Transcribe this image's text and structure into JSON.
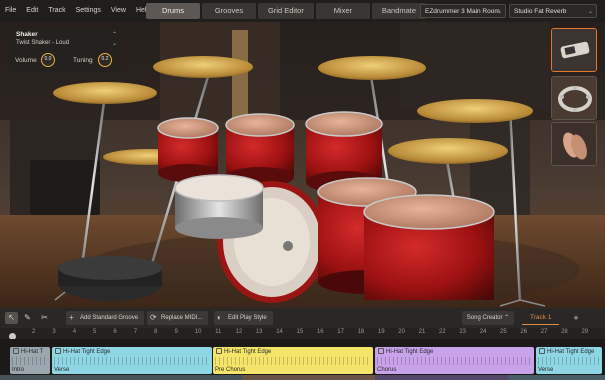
{
  "menubar": {
    "items": [
      "File",
      "Edit",
      "Track",
      "Settings",
      "View",
      "Help"
    ]
  },
  "tabs": [
    {
      "label": "Drums",
      "active": true
    },
    {
      "label": "Grooves",
      "active": false
    },
    {
      "label": "Grid Editor",
      "active": false
    },
    {
      "label": "Mixer",
      "active": false
    },
    {
      "label": "Bandmate",
      "active": false
    }
  ],
  "presets": {
    "room": "EZdrummer 3 Main Room",
    "reverb": "Studio Fat Reverb"
  },
  "instrument": {
    "name": "Shaker",
    "articulation": "Twist Shaker - Loud",
    "volume_label": "Volume",
    "volume_value": "0.0",
    "tuning_label": "Tuning",
    "tuning_value": "0.2"
  },
  "thumbnails": [
    {
      "name": "shaker",
      "selected": true
    },
    {
      "name": "tambourine",
      "selected": false
    },
    {
      "name": "hand-clap",
      "selected": false
    }
  ],
  "toolbar": {
    "add_standard_groove": "Add Standard Groove",
    "replace_midi": "Replace MIDI...",
    "edit_play_style": "Edit Play Style",
    "song_creator": "Song Creator",
    "track_name": "Track 1",
    "add_track": "+"
  },
  "ruler": {
    "ticks": [
      "2",
      "3",
      "4",
      "5",
      "6",
      "7",
      "8",
      "9",
      "10",
      "11",
      "12",
      "13",
      "14",
      "15",
      "16",
      "17",
      "18",
      "19",
      "20",
      "21",
      "22",
      "23",
      "24",
      "25",
      "26",
      "27",
      "28",
      "29"
    ]
  },
  "blocks": [
    {
      "title": "Hi-Hat T",
      "label": "Intro",
      "color": "#9aa7ae"
    },
    {
      "title": "Hi-Hat Tight Edge",
      "label": "Verse",
      "color": "#8fd6e4"
    },
    {
      "title": "Hi-Hat Tight Edge",
      "label": "Pre Chorus",
      "color": "#f4e56a"
    },
    {
      "title": "Hi-Hat Tight Edge",
      "label": "Chorus",
      "color": "#c8a2ea"
    },
    {
      "title": "Hi-Hat Tight Edge",
      "label": "Verse",
      "color": "#8fd6e4"
    }
  ]
}
